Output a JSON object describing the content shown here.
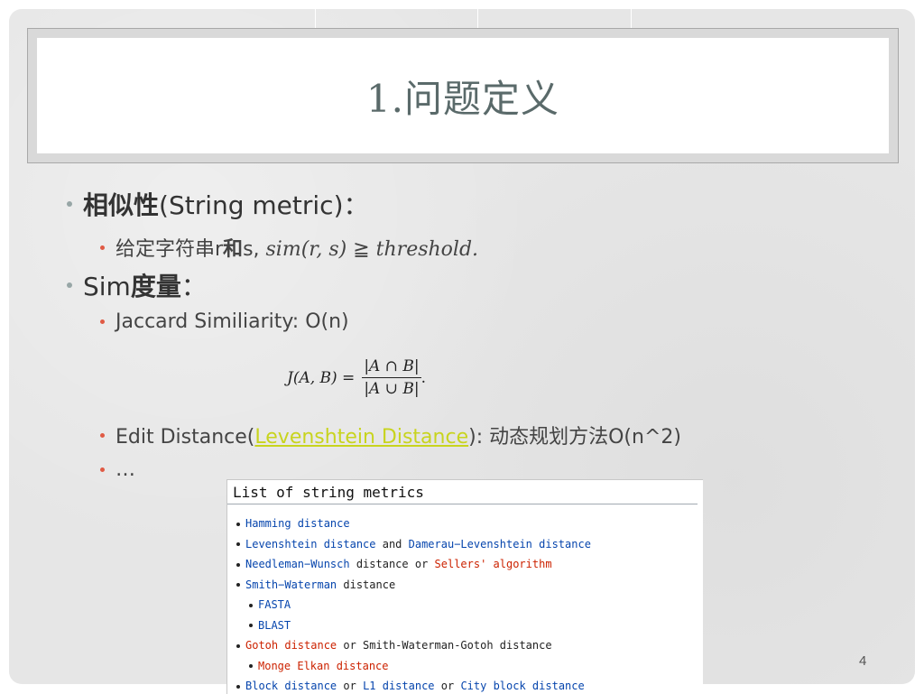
{
  "slide": {
    "title": "1.问题定义",
    "page_number": "4"
  },
  "bullets": {
    "b1_label": "相似性",
    "b1_rest": "(String metric)：",
    "b1_sub_prefix": "给定字符串r",
    "b1_sub_and": "和",
    "b1_sub_s": "s, ",
    "b1_sub_math": "sim(r, s)",
    "b1_sub_ge": " ≧ ",
    "b1_sub_thresh": "threshold.",
    "b2_label_prefix": "Sim",
    "b2_label_bold": "度量",
    "b2_label_colon": "：",
    "jaccard": "Jaccard Similiarity: O(n)",
    "edit_prefix": "Edit Distance(",
    "edit_link": "Levenshtein Distance",
    "edit_suffix": "): 动态规划方法O(n^2)",
    "ellipsis": "…"
  },
  "formula": {
    "lhs": "J(A, B) =",
    "numerator": "|A ∩ B|",
    "denominator": "|A ∪ B|",
    "tail": "."
  },
  "wiki_panel": {
    "heading": "List of string metrics",
    "items": [
      {
        "t1": "Hamming distance",
        "t2": "",
        "t3": "",
        "t4": "",
        "t5": ""
      },
      {
        "t1": "Levenshtein distance",
        "t2": " and ",
        "t3": "Damerau−Levenshtein distance",
        "t4": "",
        "t5": ""
      },
      {
        "t1": "Needleman−Wunsch",
        "t2": " distance or ",
        "t3": "Sellers' algorithm",
        "t4": "",
        "t5": ""
      },
      {
        "t1": "Smith−Waterman",
        "t2": " distance",
        "t3": "",
        "t4": "",
        "t5": ""
      },
      {
        "t1": "FASTA",
        "t2": "",
        "t3": "",
        "t4": "",
        "t5": ""
      },
      {
        "t1": "BLAST",
        "t2": "",
        "t3": "",
        "t4": "",
        "t5": ""
      },
      {
        "t1": "Gotoh distance",
        "t2": " or Smith-Waterman-Gotoh distance",
        "t3": "",
        "t4": "",
        "t5": ""
      },
      {
        "t1": "Monge Elkan distance",
        "t2": "",
        "t3": "",
        "t4": "",
        "t5": ""
      },
      {
        "t1": "Block distance",
        "t2": " or ",
        "t3": "L1 distance",
        "t4": " or ",
        "t5": "City block distance"
      }
    ]
  },
  "colors": {
    "link": "#c8d41e",
    "wiki_link_blue": "#0645ad",
    "wiki_link_red": "#cc2200",
    "title_text": "#5a6a6a"
  }
}
